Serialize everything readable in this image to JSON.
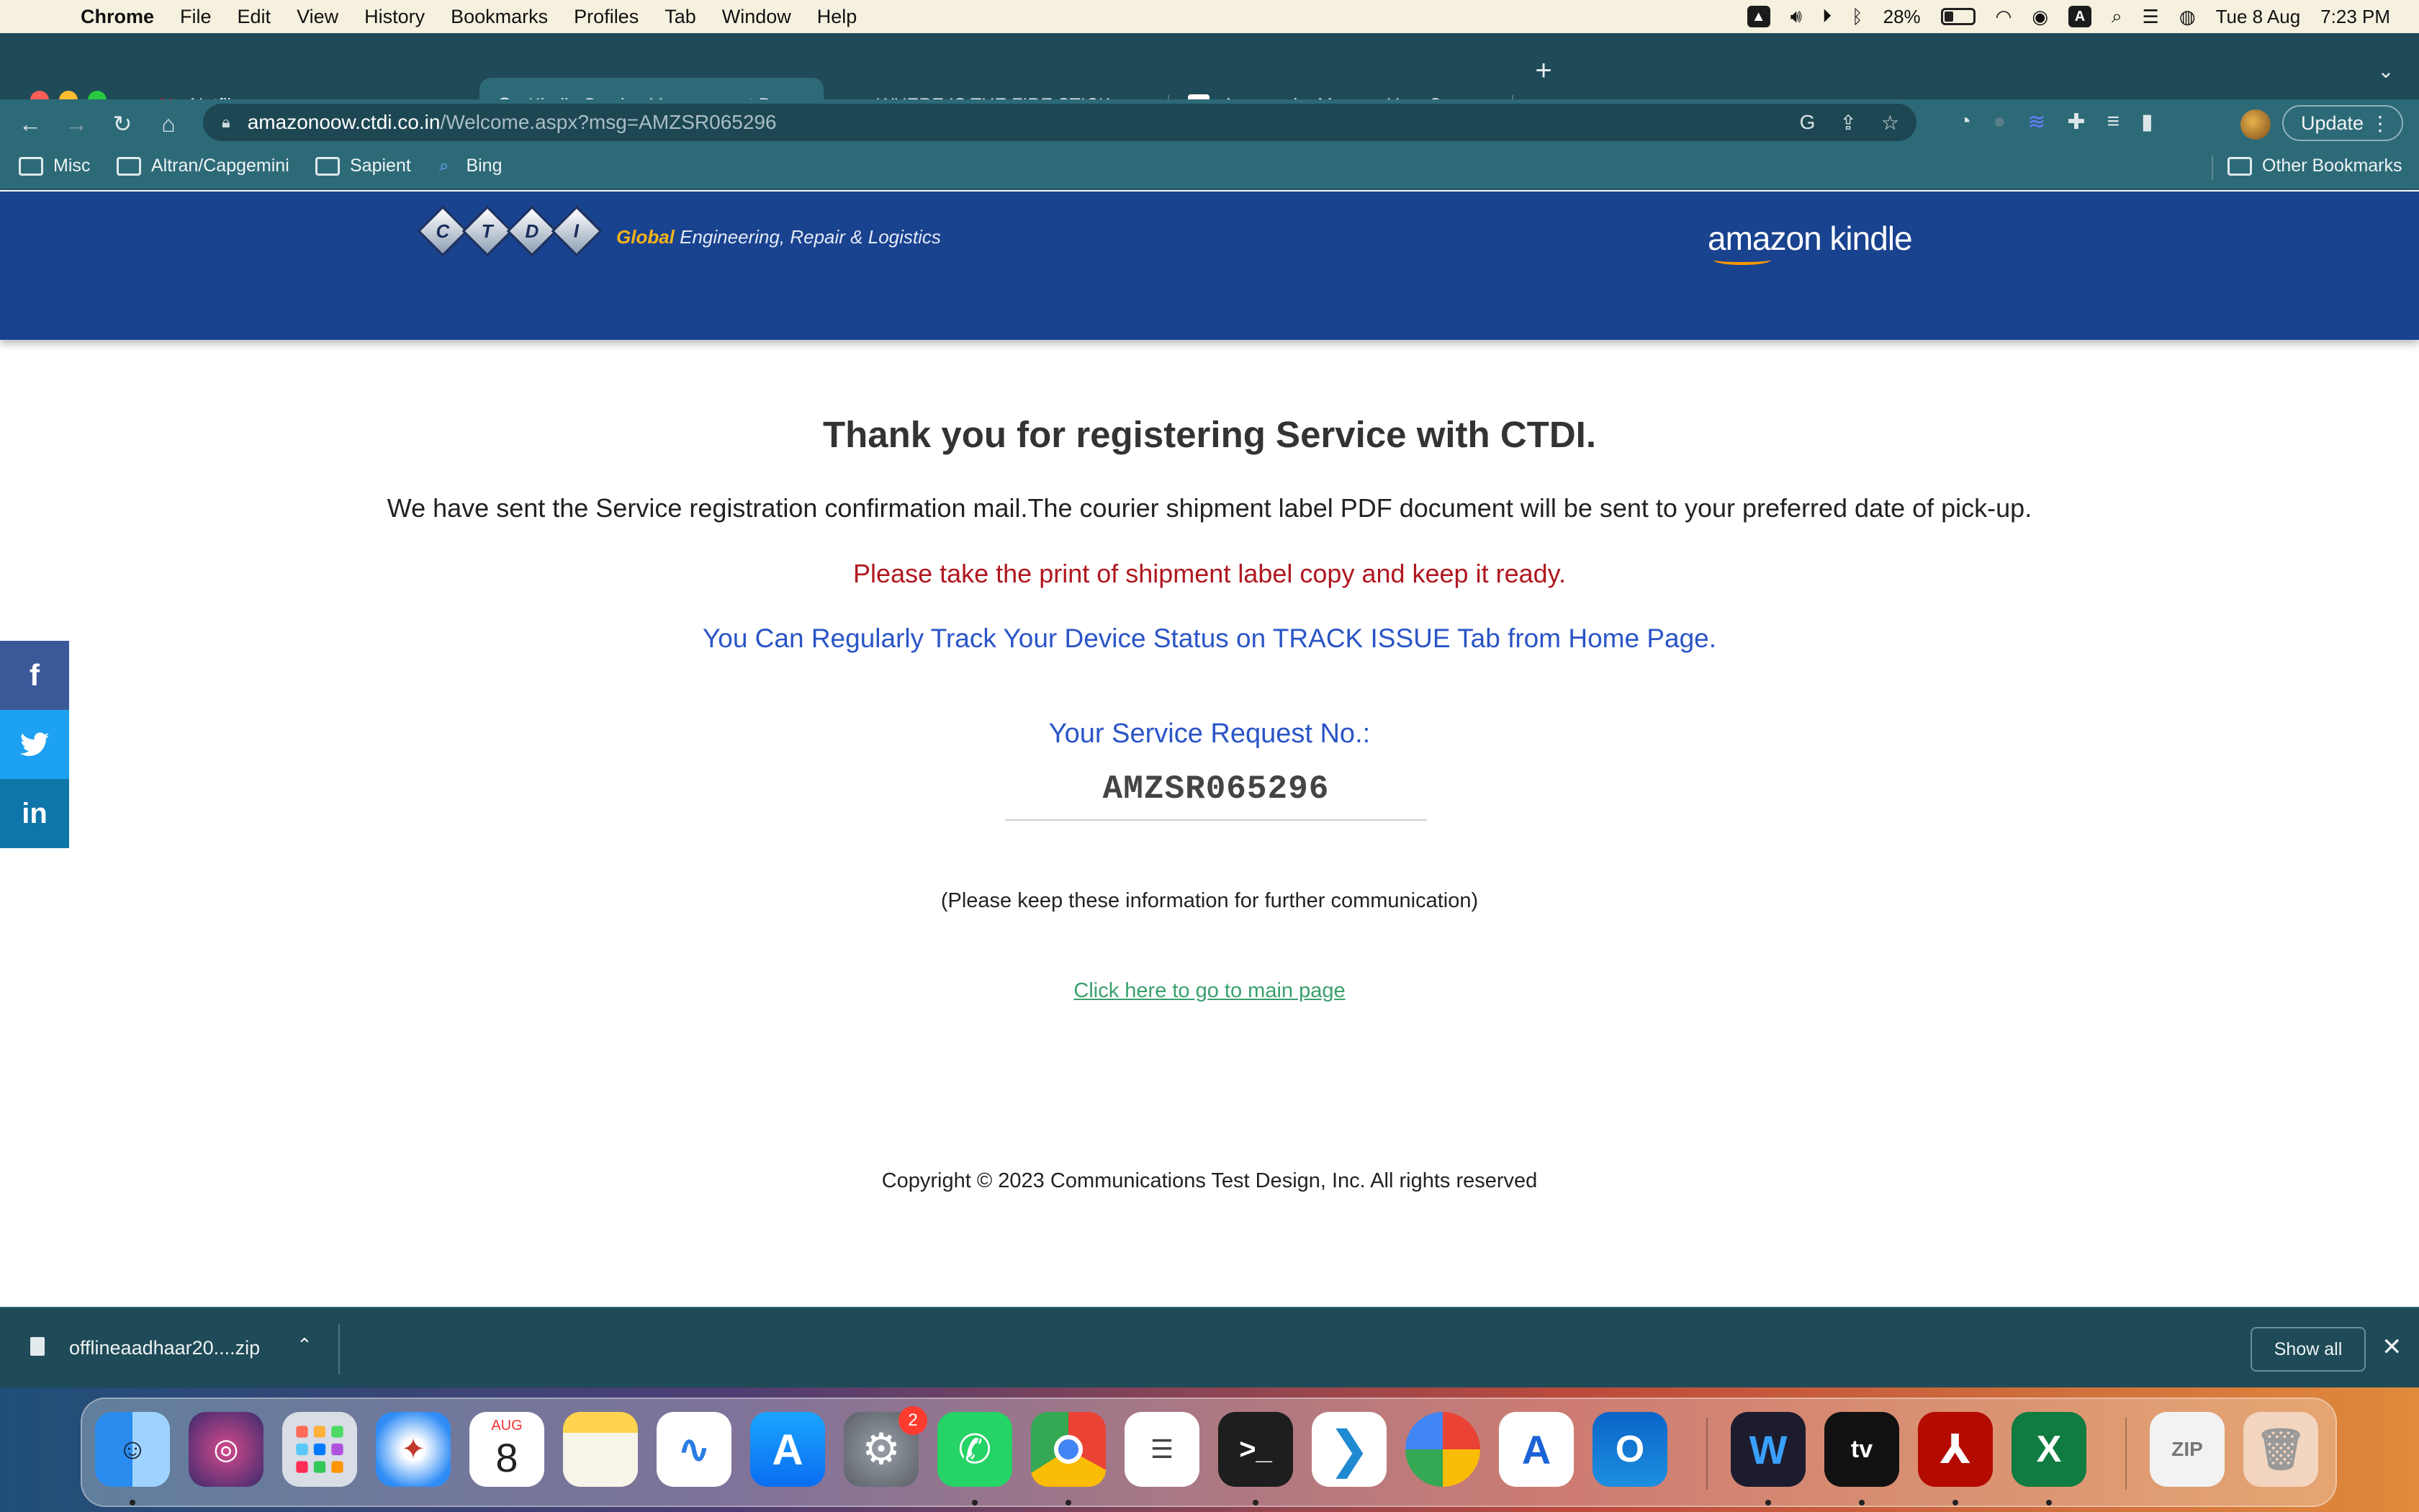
{
  "menubar": {
    "app_name": "Chrome",
    "items": [
      "File",
      "Edit",
      "View",
      "History",
      "Bookmarks",
      "Profiles",
      "Tab",
      "Window",
      "Help"
    ],
    "battery": "28%",
    "date": "Tue 8 Aug",
    "time": "7:23 PM"
  },
  "tabs": [
    {
      "title": "Netflix",
      "icon": "netflix-icon"
    },
    {
      "title": "Kindle Service Management Po",
      "icon": "globe-icon",
      "active": true
    },
    {
      "title": "WHERE IS THE FIRE STICK SER",
      "icon": "amazon-icon"
    },
    {
      "title": "Amazon.in: Manage Your Conte",
      "icon": "amazon-icon"
    }
  ],
  "omnibox": {
    "host": "amazonoow.ctdi.co.in",
    "path": "/Welcome.aspx?msg=AMZSR065296"
  },
  "toolbar": {
    "update_label": "Update"
  },
  "bookmarks": [
    "Misc",
    "Altran/Capgemini",
    "Sapient",
    "Bing"
  ],
  "other_bookmarks": "Other Bookmarks",
  "header": {
    "logo_letters": [
      "C",
      "T",
      "D",
      "I"
    ],
    "tagline_emphasis": "Global",
    "tagline_rest": " Engineering, Repair & Logistics",
    "brand": "amazon kindle"
  },
  "content": {
    "heading": "Thank you for registering Service with CTDI.",
    "sent_message": "We have sent the Service registration confirmation mail.The courier shipment label PDF document will be sent to your preferred date of pick-up.",
    "print_message": "Please take the print of shipment label copy and keep it ready.",
    "track_message": "You Can Regularly Track Your Device Status on TRACK ISSUE Tab from Home Page.",
    "request_label": "Your Service Request No.:",
    "request_number": "AMZSR065296",
    "keep_info": "(Please keep these information for further communication)",
    "main_page_link": "Click here to go to main page",
    "copyright": "Copyright © 2023 Communications Test Design, Inc. All rights reserved"
  },
  "download": {
    "filename": "offlineaadhaar20....zip",
    "show_all": "Show all"
  },
  "dock": {
    "calendar_month": "AUG",
    "calendar_day": "8",
    "settings_badge": "2"
  },
  "colors": {
    "header_blue": "#19428f",
    "chrome_frame": "#1f4a57",
    "alert_red": "#b0171f",
    "info_blue": "#2a55c7",
    "link_green": "#3aa06c"
  }
}
